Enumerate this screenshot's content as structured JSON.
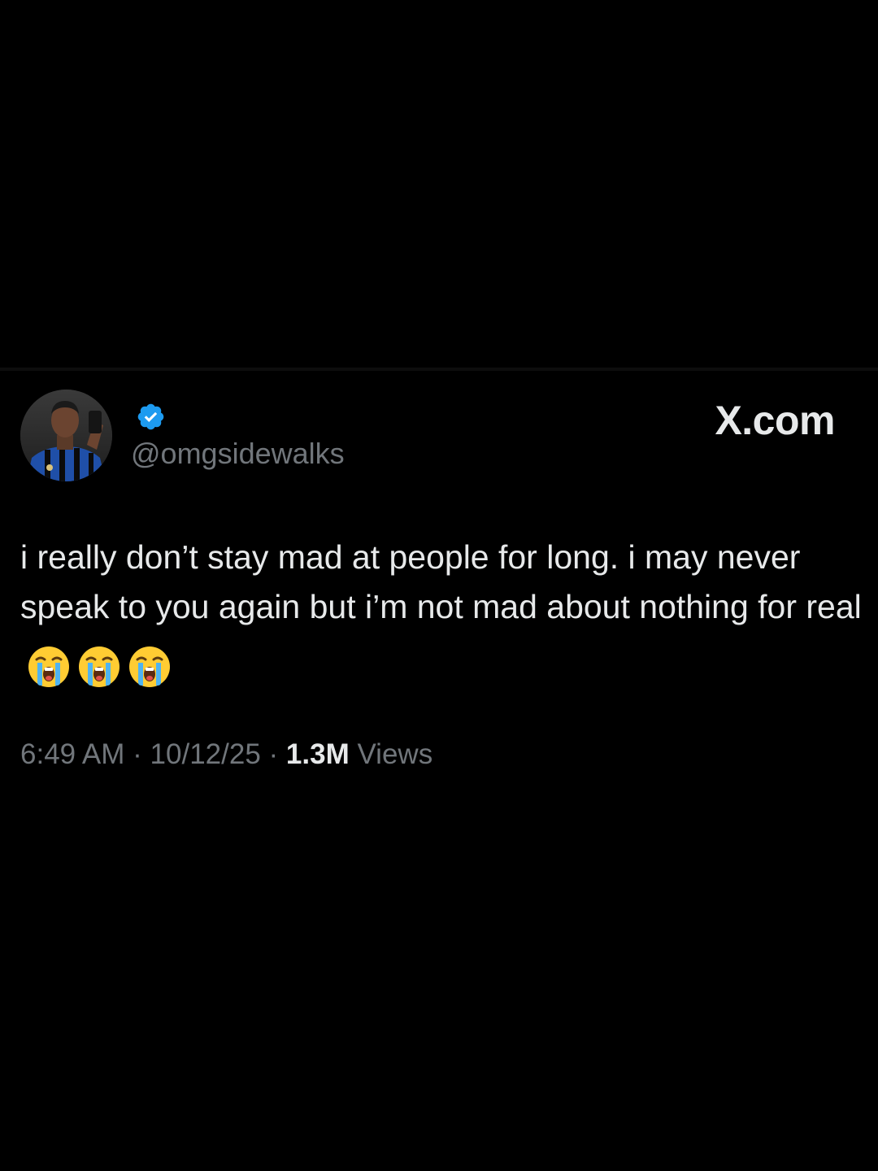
{
  "tweet": {
    "handle": "@omgsidewalks",
    "verified_icon": "verified-badge-icon",
    "brand": "X.com",
    "text": "i really don’t stay mad at people for long. i may never speak to you again but i’m not mad about nothing for real",
    "emojis": [
      "loudly-crying-face-icon",
      "loudly-crying-face-icon",
      "loudly-crying-face-icon"
    ],
    "time": "6:49 AM",
    "separator": "·",
    "date": "10/12/25",
    "views_count": "1.3M",
    "views_label": "Views"
  },
  "colors": {
    "background": "#000000",
    "text_primary": "#e7e9ea",
    "text_secondary": "#71767b",
    "verified_blue": "#1d9bf0"
  }
}
